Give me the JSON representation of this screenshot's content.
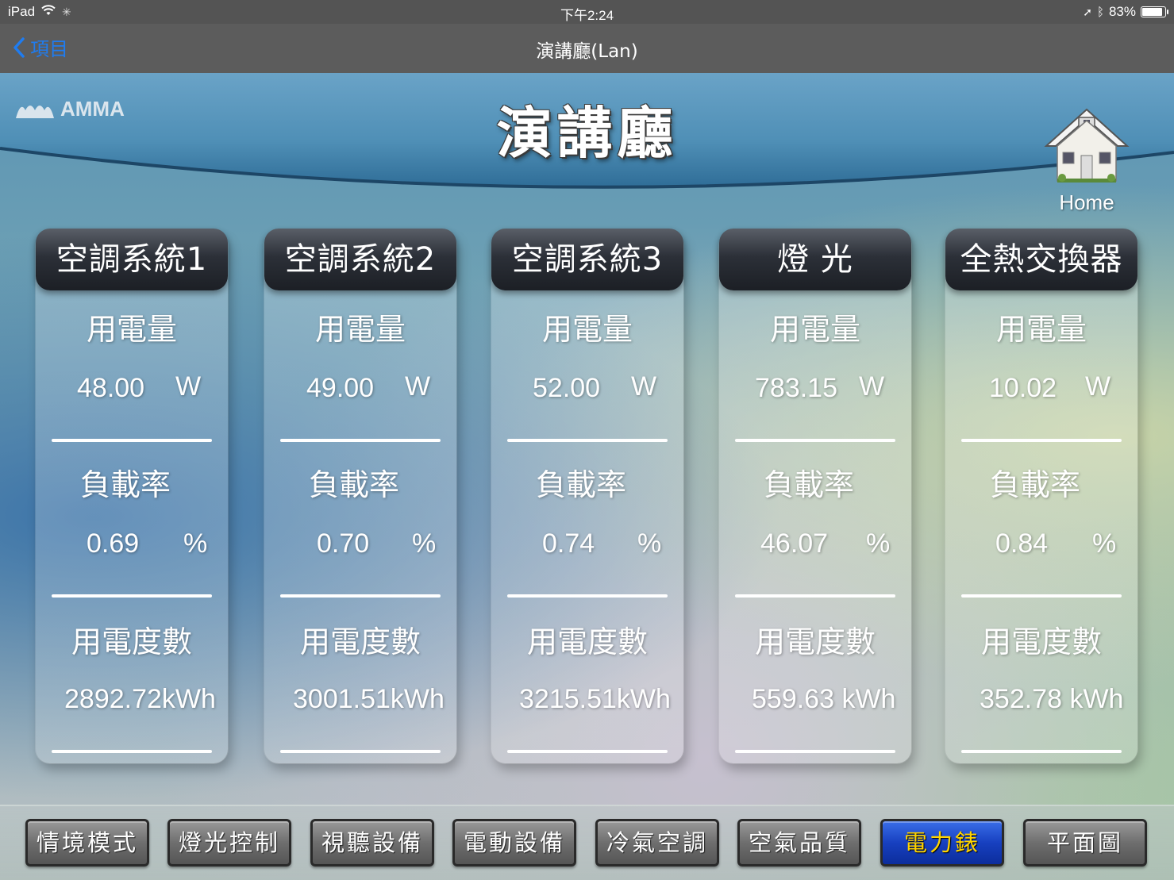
{
  "status": {
    "device": "iPad",
    "time": "下午2:24",
    "battery": "83%",
    "battery_level": 0.83
  },
  "nav": {
    "back_label": "項目",
    "title": "演講廳(Lan)"
  },
  "header": {
    "logo": "AMMA",
    "title": "演講廳",
    "home_label": "Home"
  },
  "cards": [
    {
      "name": "空調系統1",
      "power_label": "用電量",
      "power": "48.00",
      "power_unit": "W",
      "load_label": "負載率",
      "load": "0.69",
      "load_unit": "%",
      "energy_label": "用電度數",
      "energy": "2892.72kWh"
    },
    {
      "name": "空調系統2",
      "power_label": "用電量",
      "power": "49.00",
      "power_unit": "W",
      "load_label": "負載率",
      "load": "0.70",
      "load_unit": "%",
      "energy_label": "用電度數",
      "energy": "3001.51kWh"
    },
    {
      "name": "空調系統3",
      "power_label": "用電量",
      "power": "52.00",
      "power_unit": "W",
      "load_label": "負載率",
      "load": "0.74",
      "load_unit": "%",
      "energy_label": "用電度數",
      "energy": "3215.51kWh"
    },
    {
      "name": "燈 光",
      "power_label": "用電量",
      "power": "783.15",
      "power_unit": "W",
      "load_label": "負載率",
      "load": "46.07",
      "load_unit": "%",
      "energy_label": "用電度數",
      "energy": "559.63 kWh"
    },
    {
      "name": "全熱交換器",
      "power_label": "用電量",
      "power": "10.02",
      "power_unit": "W",
      "load_label": "負載率",
      "load": "0.84",
      "load_unit": "%",
      "energy_label": "用電度數",
      "energy": "352.78 kWh"
    }
  ],
  "toolbar": {
    "buttons": [
      "情境模式",
      "燈光控制",
      "視聽設備",
      "電動設備",
      "冷氣空調",
      "空氣品質",
      "電力錶",
      "平面圖"
    ],
    "active": "電力錶"
  },
  "colors": {
    "nav_back": "#1f7cf0",
    "active_button_bg": "#1740c0",
    "active_button_text": "#ffd400"
  }
}
